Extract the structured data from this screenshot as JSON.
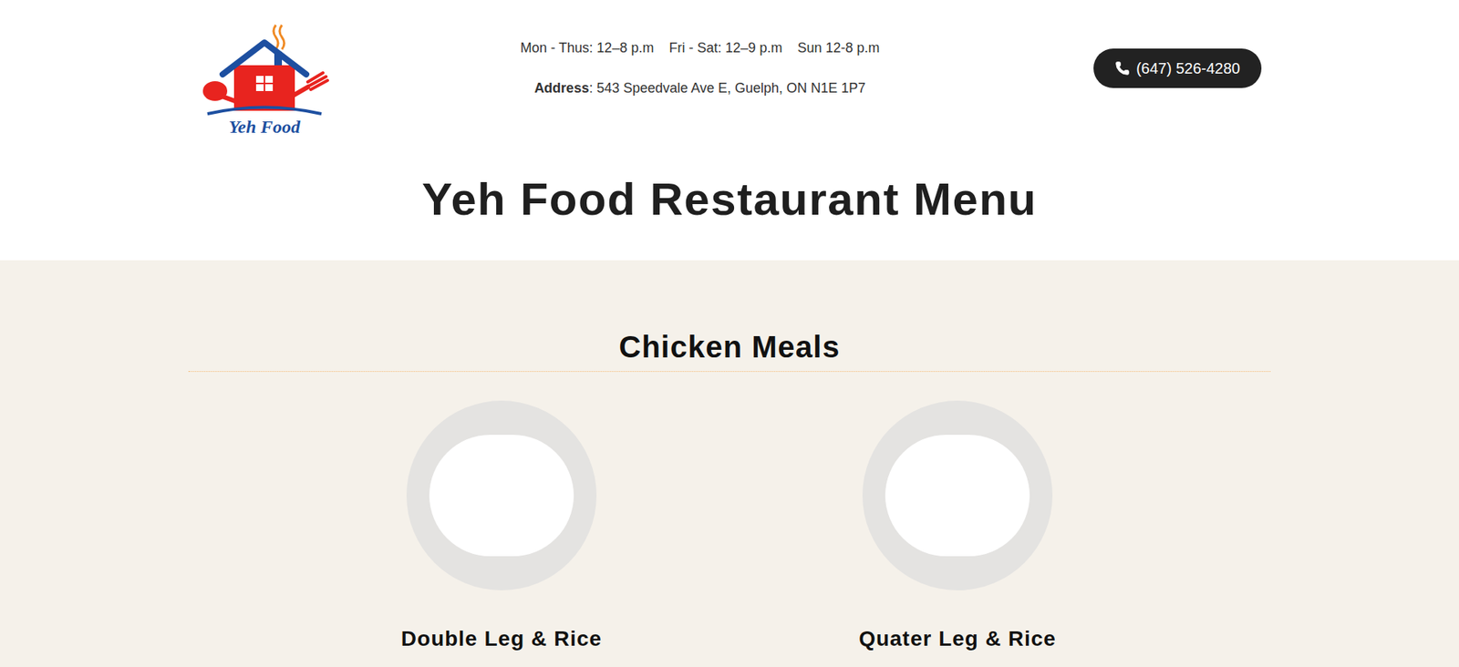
{
  "header": {
    "logo": "Yeh Food",
    "hours": [
      "Mon - Thus: 12–8 p.m",
      "Fri - Sat: 12–9 p.m",
      "Sun 12-8 p.m"
    ],
    "address": {
      "label": "Address",
      "value": ": 543 Speedvale Ave E, Guelph, ON N1E 1P7"
    },
    "phone": "(647) 526-4280"
  },
  "title": "Yeh Food Restaurant Menu",
  "sections": [
    {
      "heading": "Chicken Meals",
      "items": [
        {
          "name": "Double Leg & Rice"
        },
        {
          "name": "Quater Leg & Rice"
        }
      ]
    }
  ]
}
